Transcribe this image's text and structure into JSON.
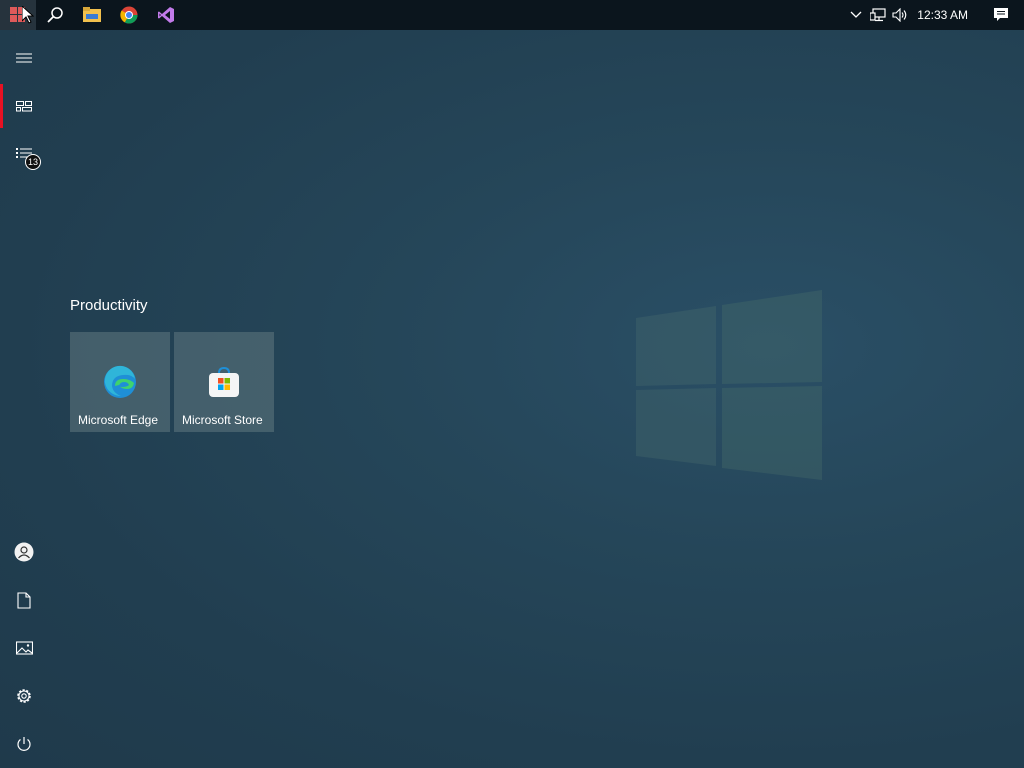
{
  "taskbar": {
    "items": [
      {
        "name": "start-button",
        "icon": "windows-icon"
      },
      {
        "name": "search-button",
        "icon": "search-icon"
      },
      {
        "name": "file-explorer-button",
        "icon": "folder-icon"
      },
      {
        "name": "chrome-button",
        "icon": "chrome-icon"
      },
      {
        "name": "visual-studio-button",
        "icon": "visual-studio-icon"
      }
    ],
    "tray": {
      "clock": "12:33 AM"
    }
  },
  "rail": {
    "badge_count": "13"
  },
  "tiles": {
    "group_title": "Productivity",
    "items": [
      {
        "label": "Microsoft Edge",
        "icon": "edge-icon"
      },
      {
        "label": "Microsoft Store",
        "icon": "store-icon"
      }
    ]
  },
  "colors": {
    "accent": "#e81123",
    "taskbar": "#0b151d",
    "tile": "#5f7880"
  }
}
